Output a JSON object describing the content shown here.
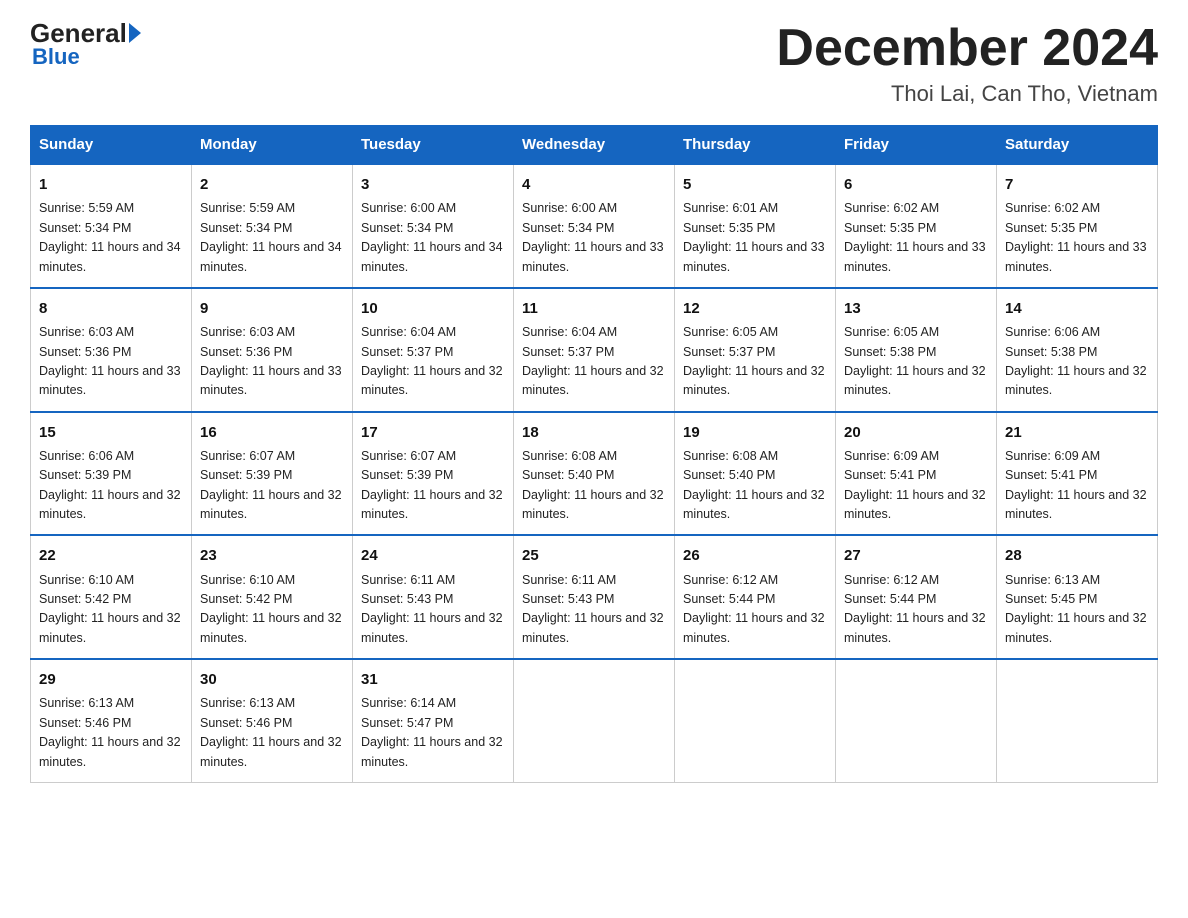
{
  "header": {
    "logo_general": "General",
    "logo_blue": "Blue",
    "month_title": "December 2024",
    "location": "Thoi Lai, Can Tho, Vietnam"
  },
  "days_of_week": [
    "Sunday",
    "Monday",
    "Tuesday",
    "Wednesday",
    "Thursday",
    "Friday",
    "Saturday"
  ],
  "weeks": [
    [
      {
        "day": 1,
        "sunrise": "5:59 AM",
        "sunset": "5:34 PM",
        "daylight": "11 hours and 34 minutes."
      },
      {
        "day": 2,
        "sunrise": "5:59 AM",
        "sunset": "5:34 PM",
        "daylight": "11 hours and 34 minutes."
      },
      {
        "day": 3,
        "sunrise": "6:00 AM",
        "sunset": "5:34 PM",
        "daylight": "11 hours and 34 minutes."
      },
      {
        "day": 4,
        "sunrise": "6:00 AM",
        "sunset": "5:34 PM",
        "daylight": "11 hours and 33 minutes."
      },
      {
        "day": 5,
        "sunrise": "6:01 AM",
        "sunset": "5:35 PM",
        "daylight": "11 hours and 33 minutes."
      },
      {
        "day": 6,
        "sunrise": "6:02 AM",
        "sunset": "5:35 PM",
        "daylight": "11 hours and 33 minutes."
      },
      {
        "day": 7,
        "sunrise": "6:02 AM",
        "sunset": "5:35 PM",
        "daylight": "11 hours and 33 minutes."
      }
    ],
    [
      {
        "day": 8,
        "sunrise": "6:03 AM",
        "sunset": "5:36 PM",
        "daylight": "11 hours and 33 minutes."
      },
      {
        "day": 9,
        "sunrise": "6:03 AM",
        "sunset": "5:36 PM",
        "daylight": "11 hours and 33 minutes."
      },
      {
        "day": 10,
        "sunrise": "6:04 AM",
        "sunset": "5:37 PM",
        "daylight": "11 hours and 32 minutes."
      },
      {
        "day": 11,
        "sunrise": "6:04 AM",
        "sunset": "5:37 PM",
        "daylight": "11 hours and 32 minutes."
      },
      {
        "day": 12,
        "sunrise": "6:05 AM",
        "sunset": "5:37 PM",
        "daylight": "11 hours and 32 minutes."
      },
      {
        "day": 13,
        "sunrise": "6:05 AM",
        "sunset": "5:38 PM",
        "daylight": "11 hours and 32 minutes."
      },
      {
        "day": 14,
        "sunrise": "6:06 AM",
        "sunset": "5:38 PM",
        "daylight": "11 hours and 32 minutes."
      }
    ],
    [
      {
        "day": 15,
        "sunrise": "6:06 AM",
        "sunset": "5:39 PM",
        "daylight": "11 hours and 32 minutes."
      },
      {
        "day": 16,
        "sunrise": "6:07 AM",
        "sunset": "5:39 PM",
        "daylight": "11 hours and 32 minutes."
      },
      {
        "day": 17,
        "sunrise": "6:07 AM",
        "sunset": "5:39 PM",
        "daylight": "11 hours and 32 minutes."
      },
      {
        "day": 18,
        "sunrise": "6:08 AM",
        "sunset": "5:40 PM",
        "daylight": "11 hours and 32 minutes."
      },
      {
        "day": 19,
        "sunrise": "6:08 AM",
        "sunset": "5:40 PM",
        "daylight": "11 hours and 32 minutes."
      },
      {
        "day": 20,
        "sunrise": "6:09 AM",
        "sunset": "5:41 PM",
        "daylight": "11 hours and 32 minutes."
      },
      {
        "day": 21,
        "sunrise": "6:09 AM",
        "sunset": "5:41 PM",
        "daylight": "11 hours and 32 minutes."
      }
    ],
    [
      {
        "day": 22,
        "sunrise": "6:10 AM",
        "sunset": "5:42 PM",
        "daylight": "11 hours and 32 minutes."
      },
      {
        "day": 23,
        "sunrise": "6:10 AM",
        "sunset": "5:42 PM",
        "daylight": "11 hours and 32 minutes."
      },
      {
        "day": 24,
        "sunrise": "6:11 AM",
        "sunset": "5:43 PM",
        "daylight": "11 hours and 32 minutes."
      },
      {
        "day": 25,
        "sunrise": "6:11 AM",
        "sunset": "5:43 PM",
        "daylight": "11 hours and 32 minutes."
      },
      {
        "day": 26,
        "sunrise": "6:12 AM",
        "sunset": "5:44 PM",
        "daylight": "11 hours and 32 minutes."
      },
      {
        "day": 27,
        "sunrise": "6:12 AM",
        "sunset": "5:44 PM",
        "daylight": "11 hours and 32 minutes."
      },
      {
        "day": 28,
        "sunrise": "6:13 AM",
        "sunset": "5:45 PM",
        "daylight": "11 hours and 32 minutes."
      }
    ],
    [
      {
        "day": 29,
        "sunrise": "6:13 AM",
        "sunset": "5:46 PM",
        "daylight": "11 hours and 32 minutes."
      },
      {
        "day": 30,
        "sunrise": "6:13 AM",
        "sunset": "5:46 PM",
        "daylight": "11 hours and 32 minutes."
      },
      {
        "day": 31,
        "sunrise": "6:14 AM",
        "sunset": "5:47 PM",
        "daylight": "11 hours and 32 minutes."
      },
      null,
      null,
      null,
      null
    ]
  ]
}
